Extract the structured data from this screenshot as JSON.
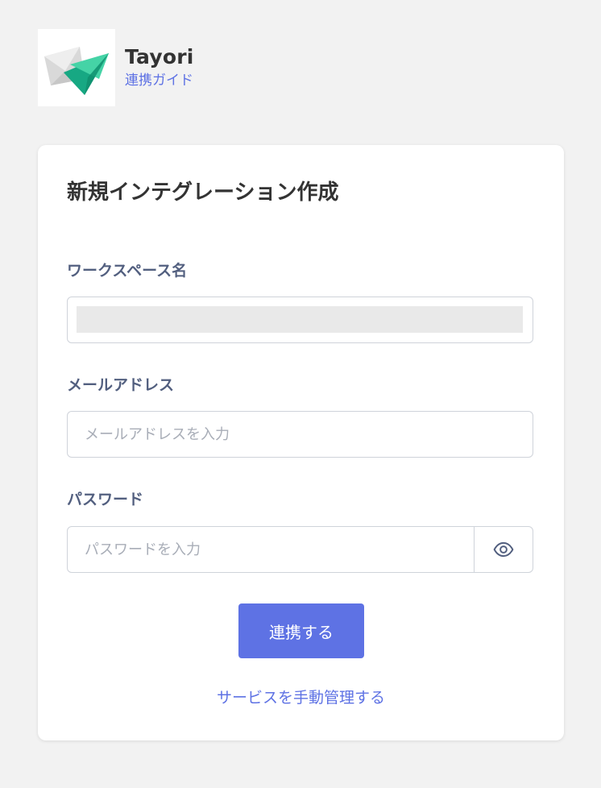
{
  "app": {
    "name": "Tayori",
    "guide_link": "連携ガイド",
    "logo_icon": "paper-plane-envelope-logo"
  },
  "form": {
    "title": "新規インテグレーション作成",
    "workspace": {
      "label": "ワークスペース名",
      "value": ""
    },
    "email": {
      "label": "メールアドレス",
      "placeholder": "メールアドレスを入力",
      "value": ""
    },
    "password": {
      "label": "パスワード",
      "placeholder": "パスワードを入力",
      "value": "",
      "toggle_icon": "eye-icon"
    },
    "submit_label": "連携する",
    "manual_link": "サービスを手動管理する"
  },
  "colors": {
    "accent": "#5e72e4",
    "label": "#525f7f",
    "background": "#f2f2f2",
    "logo_green": "#1fb58f",
    "logo_light_green": "#3fd3a4"
  }
}
